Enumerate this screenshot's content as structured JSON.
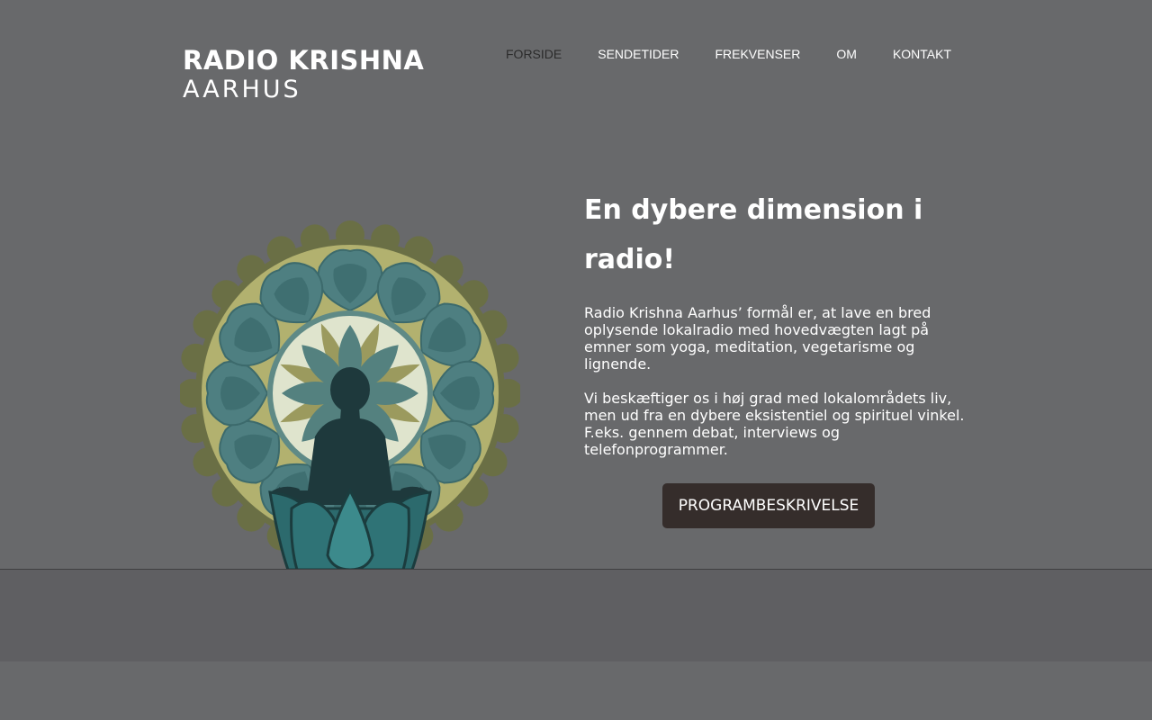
{
  "logo": {
    "line1": "RADIO KRISHNA",
    "line2": "AARHUS"
  },
  "nav": {
    "items": [
      {
        "label": "FORSIDE",
        "active": true
      },
      {
        "label": "SENDETIDER",
        "active": false
      },
      {
        "label": "FREKVENSER",
        "active": false
      },
      {
        "label": "OM",
        "active": false
      },
      {
        "label": "KONTAKT",
        "active": false
      }
    ]
  },
  "main": {
    "headline": "En dybere dimension i radio!",
    "paragraphs": [
      "Radio Krishna Aarhus’ formål er, at lave en bred oplysende lokalradio med hovedvægten lagt på emner som yoga, meditation, vegetarisme og lignende.",
      "Vi beskæftiger os i høj grad med lokalområdets liv, men ud fra en dybere eksistentiel og spirituel vinkel. F.eks. gennem debat, interviews og telefonprogrammer."
    ],
    "cta_label": "PROGRAMBESKRIVELSE"
  },
  "colors": {
    "background": "#68696b",
    "button": "#352d2b",
    "footer": "#5f5f62",
    "nav_active": "#2b2b2b"
  }
}
